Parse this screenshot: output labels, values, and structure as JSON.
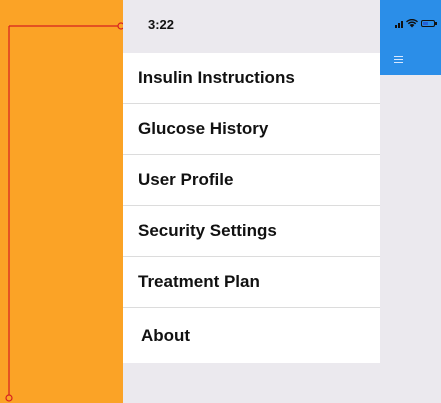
{
  "status_bar": {
    "time": "3:22"
  },
  "menu": {
    "items": [
      {
        "label": "Insulin Instructions"
      },
      {
        "label": "Glucose History"
      },
      {
        "label": "User Profile"
      },
      {
        "label": "Security Settings"
      },
      {
        "label": "Treatment Plan"
      },
      {
        "label": "About"
      }
    ]
  },
  "icons": {
    "signal": "signal-icon",
    "wifi": "wifi-icon",
    "battery": "battery-icon",
    "menu": "hamburger-menu-icon"
  },
  "colors": {
    "background": "#fba326",
    "header": "#2b8ee8",
    "annotation": "#d62020",
    "drawer": "#ffffff",
    "panel": "#ebe9ee"
  }
}
